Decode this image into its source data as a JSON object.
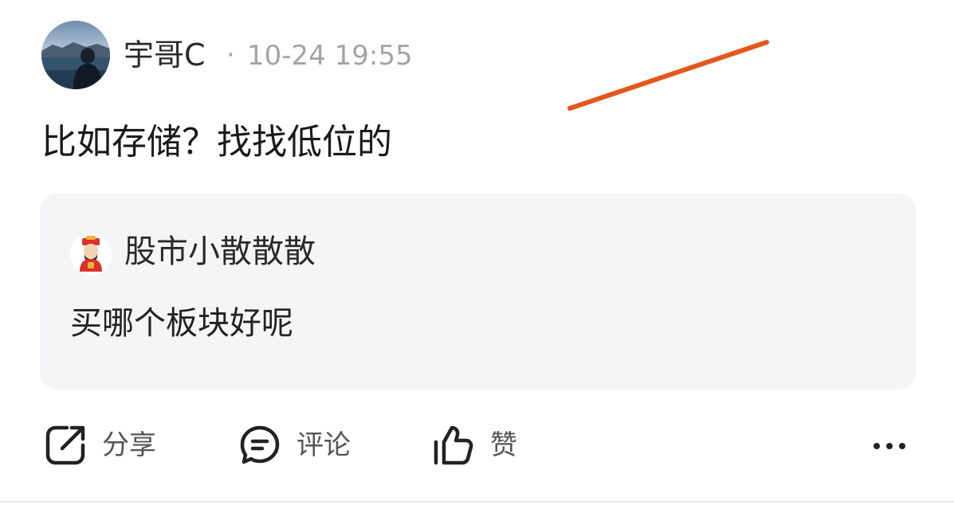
{
  "post": {
    "author": "宇哥C",
    "separator": "·",
    "timestamp": "10-24 19:55",
    "text": "比如存储？找找低位的"
  },
  "quote": {
    "author": "股市小散散散",
    "text": "买哪个板块好呢"
  },
  "actions": {
    "share_label": "分享",
    "comment_label": "评论",
    "like_label": "赞"
  },
  "icons": {
    "share": "share-icon",
    "comment": "comment-icon",
    "like": "thumbs-up-icon",
    "more": "more-dots-icon"
  },
  "colors": {
    "annotation_stroke": "#e4571b",
    "card_background": "#f5f5f7",
    "meta_text": "#a4a4a4",
    "action_text": "#555555"
  }
}
